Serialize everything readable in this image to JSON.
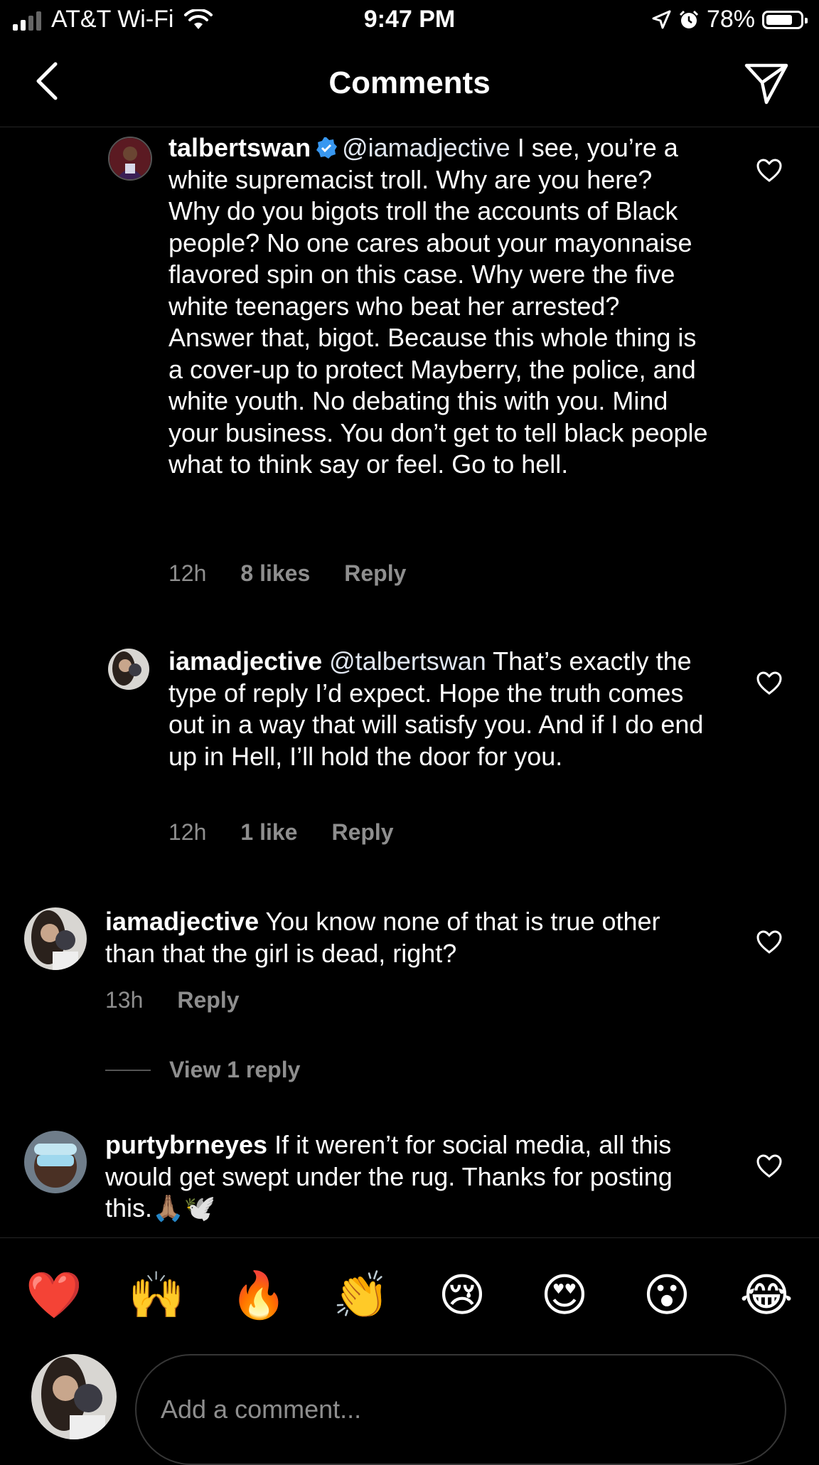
{
  "status_bar": {
    "carrier": "AT&T Wi-Fi",
    "time": "9:47 PM",
    "battery": "78%",
    "battery_level": 0.78
  },
  "nav": {
    "title": "Comments",
    "back_icon": "chevron-left-icon",
    "share_icon": "paper-plane-icon"
  },
  "comments": [
    {
      "username": "talbertswan",
      "verified": true,
      "mention": "@iamadjective",
      "body": " I see, you’re a white supremacist troll. Why are you here? Why do you bigots troll the accounts of Black people? No one cares about your mayonnaise flavored spin on this case. Why were the five white teenagers who beat her arrested? Answer that, bigot. Because this whole thing is a cover-up to protect Mayberry, the police, and white youth. No debating this with you. Mind your business. You don’t get to tell black people what to think say or feel. Go to hell.",
      "age": "12h",
      "likes": "8 likes",
      "reply": "Reply"
    },
    {
      "username": "iamadjective",
      "mention": "@talbertswan",
      "body": " That’s exactly the type of reply I’d expect. Hope the truth comes out in a way that will satisfy you. And if I do end up in Hell, I’ll hold the door for you.",
      "age": "12h",
      "likes": "1 like",
      "reply": "Reply"
    },
    {
      "username": "iamadjective",
      "body": " You know none of that is true other than that the girl is dead, right?",
      "age": "13h",
      "reply": "Reply"
    },
    {
      "username": "purtybrneyes",
      "body": " If it weren’t for social media, all this would get swept under the rug. Thanks for posting this.🙏🏽🕊️"
    }
  ],
  "view_replies": "View 1 reply",
  "emoji_bar": [
    "❤️",
    "🙌",
    "🔥",
    "👏",
    "😢",
    "😍",
    "😮",
    "😂"
  ],
  "compose": {
    "placeholder": "Add a comment..."
  },
  "colors": {
    "background": "#000000",
    "text": "#ffffff",
    "secondary_text": "#8e8e8e",
    "verified_blue": "#3897f0"
  }
}
